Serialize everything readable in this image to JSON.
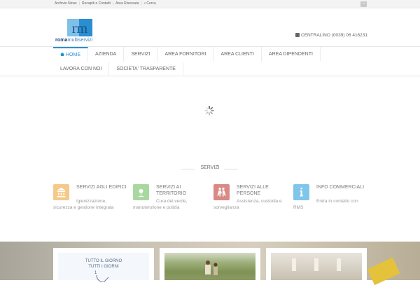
{
  "topbar": {
    "links": [
      "Archivio News",
      "Recapiti e Contatti",
      "Area Riservata"
    ],
    "search_label": "Cerca"
  },
  "header": {
    "logo_mark": "rm",
    "logo_text_bold": "roma",
    "logo_text_light": "multiservizi",
    "contact": "CENTRALINO (0039) 06 416231"
  },
  "nav": {
    "row1": [
      "HOME",
      "AZIENDA",
      "SERVIZI",
      "AREA FORNITORI",
      "AREA CLIENTI",
      "AREA DIPENDENTI"
    ],
    "row2": [
      "LAVORA CON NOI",
      "SOCIETA' TRASPARENTE"
    ],
    "active": "HOME"
  },
  "services": {
    "title": "SERVIZI",
    "items": [
      {
        "title": "SERVIZI AGLI EDIFICI",
        "desc": "Igienizzazione, sicurezza e gestione integrata",
        "color": "#f5c98a",
        "icon": "building-icon"
      },
      {
        "title": "SERVIZI AI TERRITORIO",
        "desc": "Cura del verde, manutenzione e pulizia",
        "color": "#a9d7a0",
        "icon": "plant-icon"
      },
      {
        "title": "SERVIZI ALLE PERSONE",
        "desc": "Assistenza, custodia e sorveglianza",
        "color": "#d98a86",
        "icon": "people-icon"
      },
      {
        "title": "INFO COMMERCIALI",
        "desc": "Entra in contatto con RMS",
        "color": "#7fc6ea",
        "icon": "info-icon"
      }
    ]
  },
  "cards": {
    "first_line1": "TUTTO IL GIORNO",
    "first_line2": "TUTTI I GIORNI",
    "first_number": "1"
  },
  "colors": {
    "accent": "#2a8fd0"
  }
}
